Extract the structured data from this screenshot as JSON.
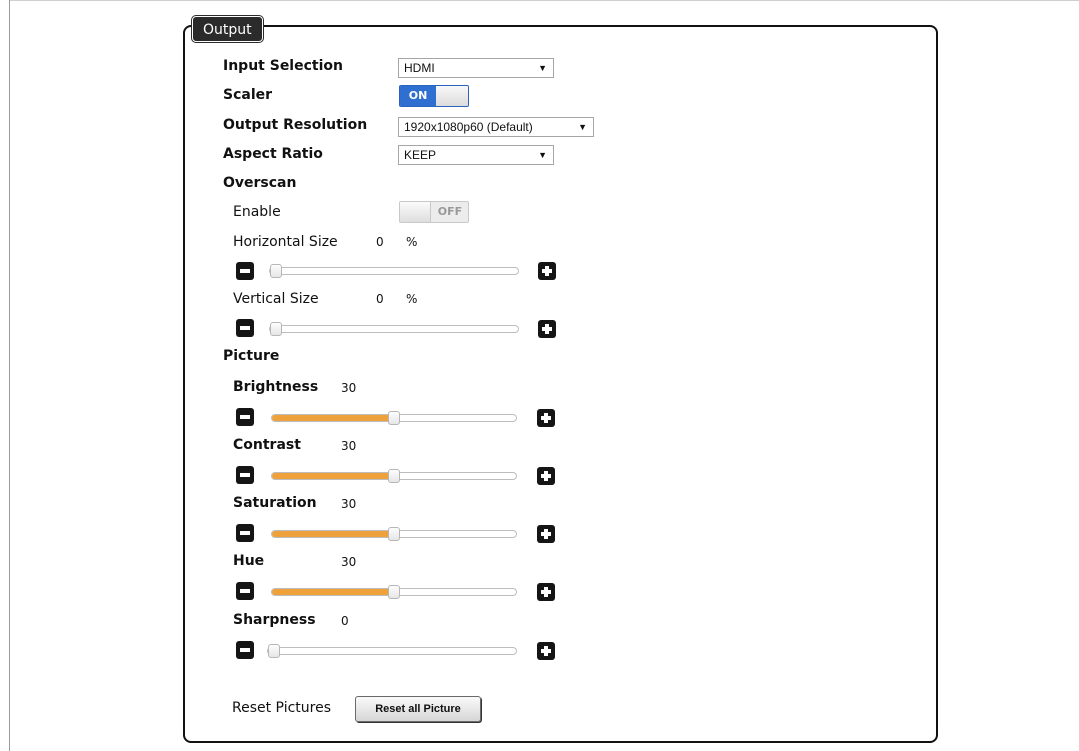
{
  "panel": {
    "title": "Output"
  },
  "settings": {
    "input_selection": {
      "label": "Input Selection",
      "value": "HDMI"
    },
    "scaler": {
      "label": "Scaler",
      "state": "ON"
    },
    "output_resolution": {
      "label": "Output Resolution",
      "value": "1920x1080p60 (Default)"
    },
    "aspect_ratio": {
      "label": "Aspect Ratio",
      "value": "KEEP"
    }
  },
  "overscan": {
    "heading": "Overscan",
    "enable": {
      "label": "Enable",
      "state": "OFF"
    },
    "horizontal": {
      "label": "Horizontal Size",
      "value": "0",
      "unit": "%",
      "level": 0
    },
    "vertical": {
      "label": "Vertical Size",
      "value": "0",
      "unit": "%",
      "level": 0
    }
  },
  "picture": {
    "heading": "Picture",
    "sliders": [
      {
        "label": "Brightness",
        "value": "30",
        "level": 0.5
      },
      {
        "label": "Contrast",
        "value": "30",
        "level": 0.5
      },
      {
        "label": "Saturation",
        "value": "30",
        "level": 0.5
      },
      {
        "label": "Hue",
        "value": "30",
        "level": 0.5
      },
      {
        "label": "Sharpness",
        "value": "0",
        "level": 0
      }
    ],
    "reset_label": "Reset Pictures",
    "reset_button": "Reset all Picture"
  },
  "colors": {
    "accent_fill": "#efa23b",
    "toggle_on": "#2f6fd0"
  }
}
